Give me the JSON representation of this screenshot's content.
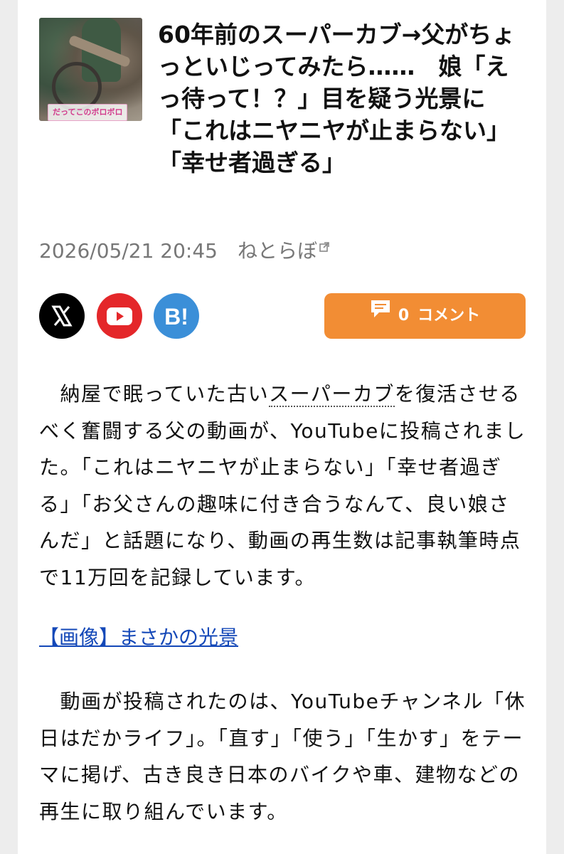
{
  "article": {
    "thumbnail_caption": "だってこのボロボロ",
    "title": "60年前のスーパーカブ→父がちょっといじってみたら……　娘「えっ待って！？」目を疑う光景に「これはニヤニヤが止まらない」「幸せ者過ぎる」",
    "datetime": "2026/05/21 20:45",
    "source": "ねとらぼ"
  },
  "share": {
    "x_icon": "x-logo-icon",
    "youtube_icon": "youtube-icon",
    "hatena_icon": "hatena-bookmark-icon",
    "hatena_label": "B!",
    "comment_count": "0",
    "comment_label": "コメント"
  },
  "body": {
    "p1_before": "　納屋で眠っていた古い",
    "p1_keyword": "スーパーカブ",
    "p1_after": "を復活させるべく奮闘する父の動画が、YouTubeに投稿されました。「これはニヤニヤが止まらない」「幸せ者過ぎる」「お父さんの趣味に付き合うなんて、良い娘さんだ」と話題になり、動画の再生数は記事執筆時点で11万回を記録しています。",
    "image_link": "【画像】まさかの光景",
    "p2": "　動画が投稿されたのは、YouTubeチャンネル「休日はだかライフ」。「直す」「使う」「生かす」をテーマに掲げ、古き良き日本のバイクや車、建物などの再生に取り組んでいます。"
  },
  "colors": {
    "accent_orange": "#f28d34",
    "link_blue": "#1448b8",
    "youtube_red": "#e4272a",
    "hatena_blue": "#3b8fd8"
  }
}
